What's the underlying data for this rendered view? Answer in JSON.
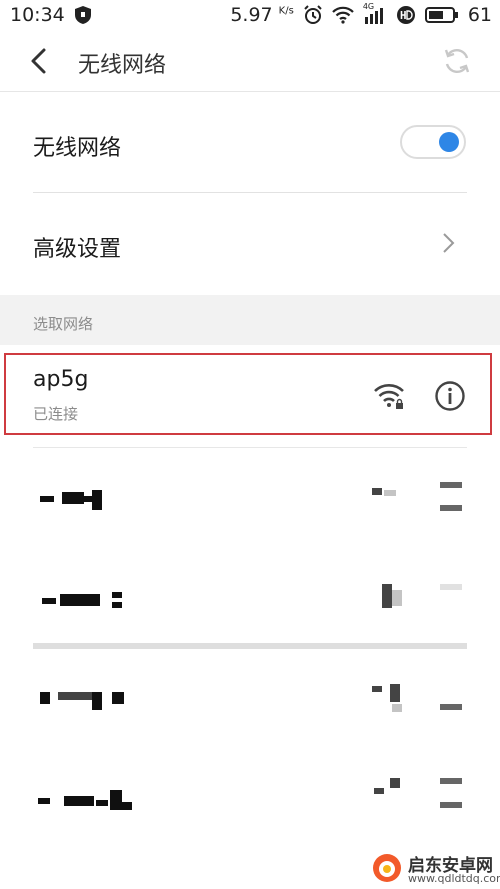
{
  "status_bar": {
    "time": "10:34",
    "net_speed": "5.97",
    "net_speed_unit": "K/s",
    "network_type": "4G",
    "battery": "61"
  },
  "header": {
    "title": "无线网络"
  },
  "wifi_toggle": {
    "label": "无线网络",
    "enabled": true
  },
  "advanced": {
    "label": "高级设置"
  },
  "networks_section": {
    "title": "选取网络",
    "connected": {
      "name": "ap5g",
      "status": "已连接"
    }
  },
  "watermark": {
    "title": "启东安卓网",
    "url": "www.qdldtdq.com"
  },
  "colors": {
    "accent": "#2e86e6",
    "highlight": "#cf3b40"
  },
  "icons": [
    "back-arrow-icon",
    "refresh-icon",
    "chevron-right-icon",
    "wifi-lock-icon",
    "info-icon",
    "shield-icon",
    "alarm-icon",
    "wifi-icon",
    "signal-icon",
    "hd-icon",
    "battery-icon"
  ]
}
